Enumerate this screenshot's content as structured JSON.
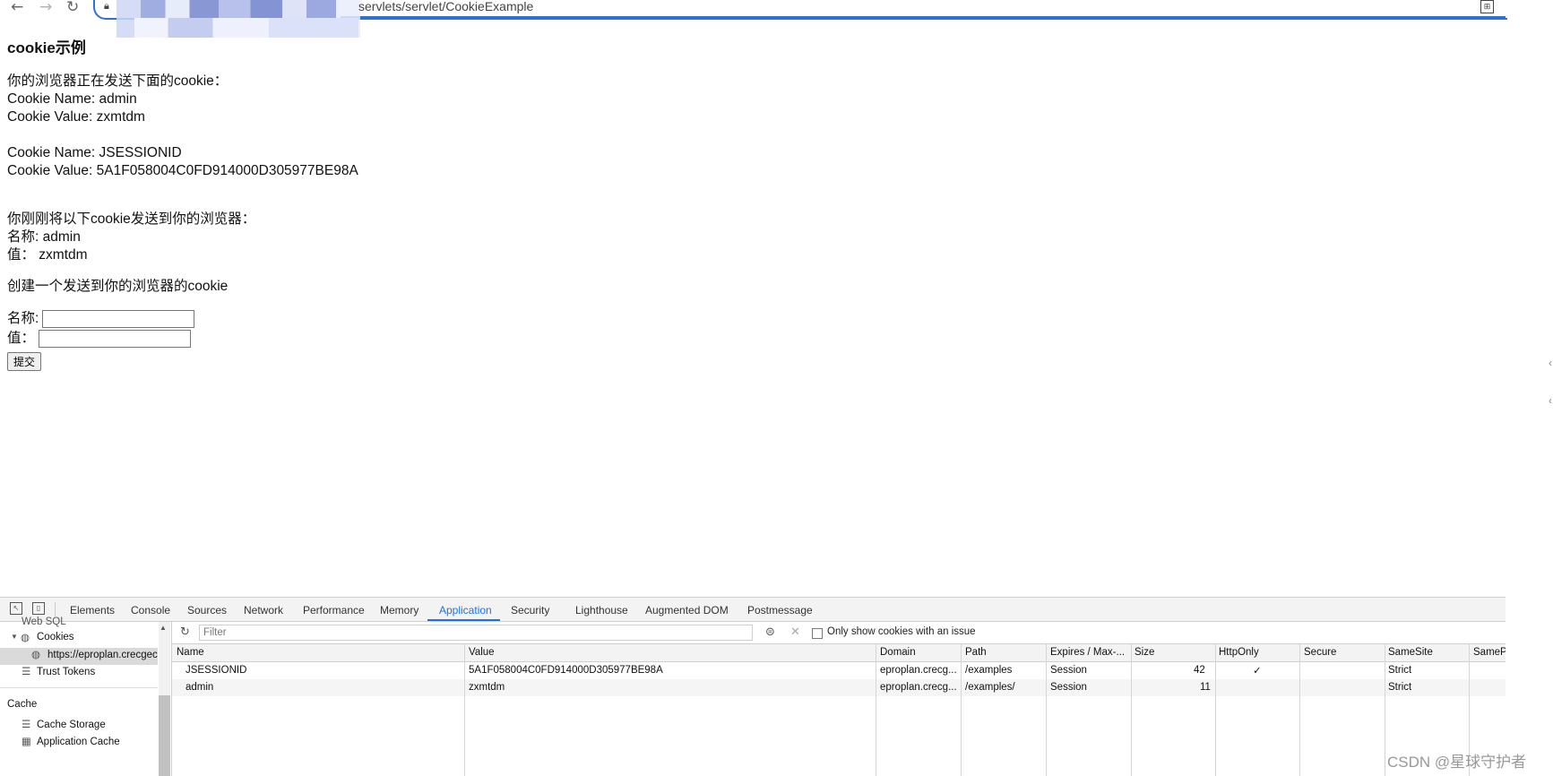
{
  "browser": {
    "url_visible": "servlets/servlet/CookieExample"
  },
  "page": {
    "title": "cookie示例",
    "sending_heading": "你的浏览器正在发送下面的cookie：",
    "cookies_sent": [
      {
        "name_line": "Cookie Name: admin",
        "value_line": "Cookie Value: zxmtdm"
      },
      {
        "name_line": "Cookie Name: JSESSIONID",
        "value_line": "Cookie Value: 5A1F058004C0FD914000D305977BE98A"
      }
    ],
    "just_sent_heading": "你刚刚将以下cookie发送到你的浏览器：",
    "just_sent_name": "名称: admin",
    "just_sent_value": "值：  zxmtdm",
    "create_heading": "创建一个发送到你的浏览器的cookie",
    "form": {
      "name_label": "名称:",
      "value_label": "值：",
      "name_value": "",
      "value_value": "",
      "submit_label": "提交"
    }
  },
  "devtools": {
    "tabs": [
      "Elements",
      "Console",
      "Sources",
      "Network",
      "Performance",
      "Memory",
      "Application",
      "Security",
      "Lighthouse",
      "Augmented DOM",
      "Postmessage"
    ],
    "active_tab": "Application",
    "sidebar": {
      "partial_top": "Web SQL",
      "cookies_label": "Cookies",
      "cookie_origin": "https://eproplan.crecgec",
      "trust_tokens": "Trust Tokens",
      "cache_section": "Cache",
      "cache_storage": "Cache Storage",
      "application_cache": "Application Cache"
    },
    "filter": {
      "placeholder": "Filter",
      "only_issues_label": "Only show cookies with an issue",
      "only_issues_checked": false
    },
    "table": {
      "columns": [
        "Name",
        "Value",
        "Domain",
        "Path",
        "Expires / Max-...",
        "Size",
        "HttpOnly",
        "Secure",
        "SameSite",
        "SamePa"
      ],
      "rows": [
        {
          "name": "JSESSIONID",
          "value": "5A1F058004C0FD914000D305977BE98A",
          "domain": "eproplan.crecg...",
          "path": "/examples",
          "expires": "Session",
          "size": "42",
          "httponly": "✓",
          "secure": "",
          "samesite": "Strict",
          "samepa": ""
        },
        {
          "name": "admin",
          "value": "zxmtdm",
          "domain": "eproplan.crecg...",
          "path": "/examples/",
          "expires": "Session",
          "size": "11",
          "httponly": "",
          "secure": "",
          "samesite": "Strict",
          "samepa": ""
        }
      ]
    }
  },
  "watermark": "CSDN @星球守护者",
  "colors": {
    "accent": "#1a73e8",
    "address_border": "#2f6fd6"
  }
}
